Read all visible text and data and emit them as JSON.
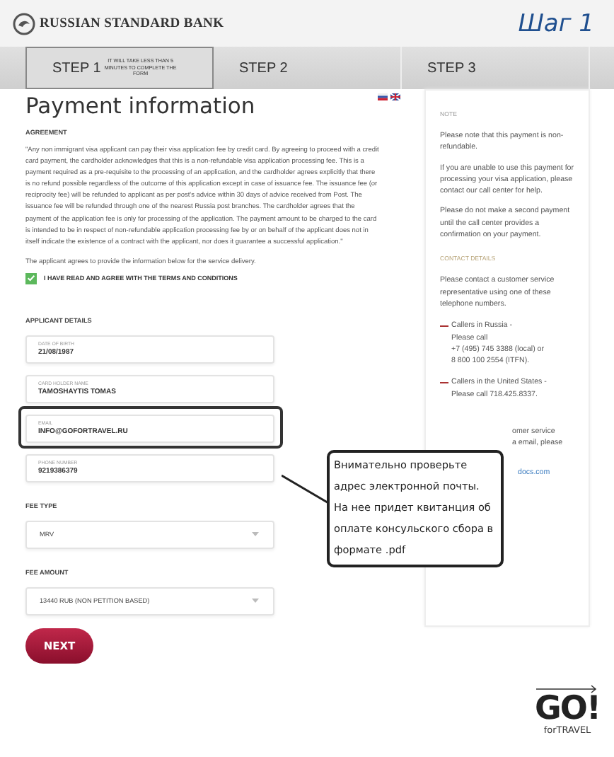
{
  "header": {
    "bank_name": "RUSSIAN STANDARD BANK",
    "step_caption": "Шаг 1"
  },
  "steps": [
    {
      "label": "STEP 1",
      "selected": true,
      "hint": "IT WILL TAKE LESS THAN 5 MINUTES TO COMPLETE THE FORM"
    },
    {
      "label": "STEP 2",
      "selected": false
    },
    {
      "label": "STEP 3",
      "selected": false
    }
  ],
  "title": "Payment information",
  "agreement": {
    "heading": "AGREEMENT",
    "text": "\"Any non immigrant visa applicant can pay their visa application fee by credit card. By agreeing to proceed with a credit card payment, the cardholder acknowledges that this is a non-refundable visa application processing fee. This is a payment required as a pre-requisite to the processing of an application, and the cardholder agrees explicitly that there is no refund possible regardless of the outcome of this application except in case of issuance fee. The issuance fee (or reciprocity fee) will be refunded to applicant as per post's advice within 30 days of advice received from Post. The issuance fee will be refunded through one of the nearest Russia post branches. The cardholder agrees that the payment of the application fee is only for processing of the application. The payment amount to be charged to the card is intended to be in respect of non-refundable application processing fee by or on behalf of the applicant does not in itself indicate the existence of a contract with the applicant, nor does it guarantee a successful application.\"",
    "note": "The applicant agrees to provide the information below for the service delivery.",
    "checkbox": {
      "label": "I HAVE READ AND AGREE WITH THE TERMS AND CONDITIONS",
      "checked": true
    }
  },
  "applicant_details": {
    "heading": "APPLICANT DETAILS",
    "fields": [
      {
        "label": "DATE OF BIRTH",
        "value": "21/08/1987",
        "highlighted": false
      },
      {
        "label": "CARD HOLDER NAME",
        "value": "TAMOSHAYTIS TOMAS",
        "highlighted": false
      },
      {
        "label": "EMAIL",
        "value": "INFO@GOFORTRAVEL.RU",
        "highlighted": true
      },
      {
        "label": "PHONE NUMBER",
        "value": "9219386379",
        "highlighted": false
      }
    ]
  },
  "selects": [
    {
      "heading": "FEE TYPE",
      "value": "MRV"
    },
    {
      "heading": "FEE AMOUNT",
      "value": "13440 RUB (NON PETITION BASED)"
    }
  ],
  "next_button": "NEXT",
  "sidebar": {
    "note_heading": "NOTE",
    "paragraphs": [
      "Please note that this payment is non-refundable.",
      "If you are unable to use this payment for processing your visa application, please contact our call center for help.",
      "Please do not make a second payment until the call center provides a confirmation on your payment."
    ],
    "contact_heading": "CONTACT DETAILS",
    "contact_text": "Please contact a customer service representative using one of these telephone numbers.",
    "callers": [
      {
        "title": "Callers in Russia -",
        "lines": [
          "Please call",
          "+7 (495) 745 3388 (local) or",
          "8 800 100 2554 (ITFN)."
        ]
      },
      {
        "title": "Callers in the United States -",
        "lines": [
          "Please call 718.425.8337."
        ]
      }
    ],
    "partial_lines": [
      "omer service",
      "a email, please"
    ],
    "partial_link": "docs.com"
  },
  "callout": "Внимательно проверьте адрес электронной почты. На нее придет квитанция об оплате консульского сбора в формате .pdf",
  "brand": {
    "main": "GO!",
    "sub": "forTRAVEL"
  }
}
